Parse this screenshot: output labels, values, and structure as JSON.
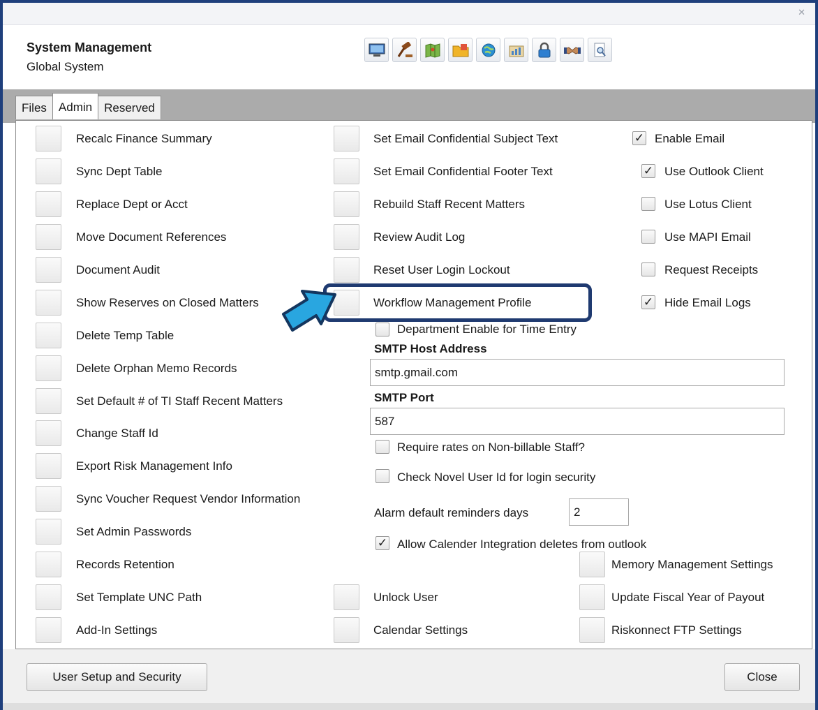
{
  "window": {
    "close_glyph": "✕"
  },
  "header": {
    "title": "System Management",
    "subtitle": "Global System"
  },
  "toolbar": {
    "icons": [
      "computer-icon",
      "gavel-icon",
      "map-icon",
      "folder-icon",
      "globe-icon",
      "chart-icon",
      "lock-icon",
      "handshake-icon",
      "search-document-icon"
    ]
  },
  "tabs": [
    {
      "label": "Files"
    },
    {
      "label": "Admin"
    },
    {
      "label": "Reserved"
    }
  ],
  "left_column": [
    "Recalc Finance Summary",
    "Sync Dept Table",
    "Replace Dept or Acct",
    "Move Document References",
    "Document Audit",
    "Show Reserves on Closed Matters",
    "Delete Temp Table",
    "Delete Orphan Memo Records",
    "Set Default # of TI Staff Recent Matters",
    "Change Staff Id",
    "Export Risk Management Info",
    "Sync Voucher Request Vendor Information",
    "Set Admin Passwords",
    "Records Retention",
    "Set Template UNC Path",
    "Add-In Settings"
  ],
  "middle_column": [
    "Set Email Confidential Subject Text",
    "Set Email Confidential Footer Text",
    "Rebuild Staff Recent Matters",
    "Review Audit Log",
    "Reset User Login Lockout",
    "Workflow Management Profile"
  ],
  "email_options": [
    {
      "label": "Enable Email",
      "checked": true
    },
    {
      "label": "Use Outlook Client",
      "checked": true
    },
    {
      "label": "Use Lotus Client",
      "checked": false
    },
    {
      "label": "Use MAPI Email",
      "checked": false
    },
    {
      "label": "Request Receipts",
      "checked": false
    },
    {
      "label": "Hide Email Logs",
      "checked": true
    }
  ],
  "dept_time_entry": {
    "label": "Department Enable for Time Entry",
    "checked": false
  },
  "smtp": {
    "host_label": "SMTP Host Address",
    "host_value": "smtp.gmail.com",
    "port_label": "SMTP Port",
    "port_value": "587"
  },
  "require_rates": {
    "label": "Require rates on Non-billable Staff?",
    "checked": false
  },
  "check_novel": {
    "label": "Check Novel User Id for login security",
    "checked": false
  },
  "alarm": {
    "label": "Alarm default reminders days",
    "value": "2"
  },
  "calendar_integration": {
    "label": "Allow Calender Integration deletes from outlook",
    "checked": true
  },
  "bottom_mid": [
    "Unlock User",
    "Calendar Settings"
  ],
  "right_column": [
    "Memory Management Settings",
    "Update Fiscal Year of Payout",
    "Riskonnect FTP Settings"
  ],
  "footer": {
    "user_setup_label": "User Setup and Security",
    "close_label": "Close"
  },
  "colors": {
    "frame": "#1f3f7c",
    "highlight": "#1f3a70",
    "arrow": "#29a6e0"
  }
}
